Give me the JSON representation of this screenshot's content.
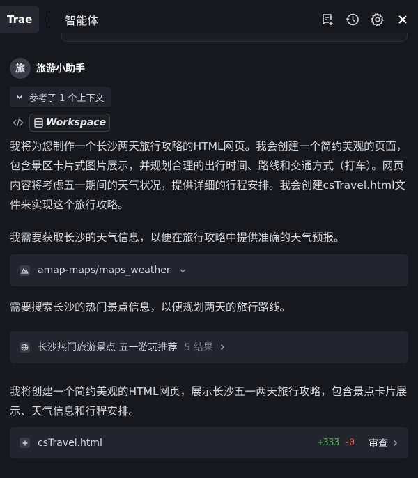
{
  "header": {
    "app_tab": "Trae",
    "title": "智能体"
  },
  "agent": {
    "avatar_text": "旅",
    "name": "旅游小助手"
  },
  "context": {
    "pill_label": "参考了 1 个上下文",
    "workspace_label": "Workspace"
  },
  "messages": {
    "intro": "我将为您制作一个长沙两天旅行攻略的HTML网页。我会创建一个简约美观的页面，包含景区卡片式图片展示，并规划合理的出行时间、路线和交通方式（打车）。网页内容将考虑五一期间的天气状况，提供详细的行程安排。我会创建csTravel.html文件来实现这个旅行攻略。",
    "weather_note": "我需要获取长沙的天气信息，以便在旅行攻略中提供准确的天气预报。",
    "search_note": "需要搜索长沙的热门景点信息，以便规划两天的旅行路线。",
    "create_note": "我将创建一个简约美观的HTML网页，展示长沙五一两天旅行攻略，包含景点卡片展示、天气信息和行程安排。"
  },
  "tool_calls": {
    "weather": {
      "label": "amap-maps/maps_weather"
    },
    "search": {
      "label": "长沙热门旅游景点 五一游玩推荐",
      "result": "5 结果"
    },
    "file": {
      "name": "csTravel.html",
      "added": "+333",
      "removed": "-0",
      "review_label": "审查"
    }
  },
  "colors": {
    "background": "#17181d",
    "card": "#23252c",
    "added": "#3fb950",
    "removed": "#e5534b"
  },
  "icons": [
    "new-chat-icon",
    "history-icon",
    "gear-icon",
    "close-icon",
    "chevron-down-icon",
    "code-icon",
    "database-icon",
    "map-tool-icon",
    "globe-icon",
    "file-add-icon",
    "chevron-right-icon"
  ]
}
